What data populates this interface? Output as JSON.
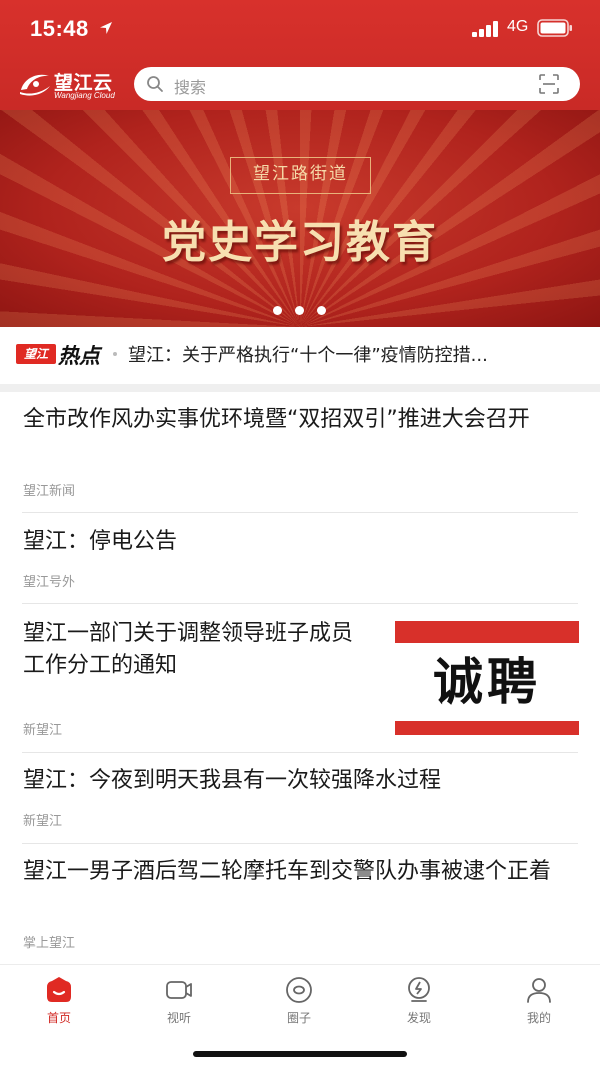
{
  "status_bar": {
    "time": "15:48",
    "network": "4G"
  },
  "header": {
    "logo_text": "望江云",
    "logo_subtext": "Wangjiang Cloud",
    "search_placeholder": "搜索"
  },
  "banner": {
    "tag": "望江路街道",
    "title": "党史学习教育",
    "slide_count": 3,
    "active_slide": 1
  },
  "hot_news": {
    "badge": "望江",
    "label": "热点",
    "text": "望江：关于严格执行“十个一律”疫情防控措..."
  },
  "feed": [
    {
      "title": "全市改作风办实事优环境暨“双招双引”推进大会召开",
      "source": "望江新闻"
    },
    {
      "title": "望江：停电公告",
      "source": "望江号外"
    },
    {
      "title": "望江一部门关于调整领导班子成员工作分工的通知",
      "source": "新望江",
      "thumbnail_text": "诚聘"
    },
    {
      "title": "望江：今夜到明天我县有一次较强降水过程",
      "source": "新望江"
    },
    {
      "title": "望江一男子酒后驾二轮摩托车到交警队办事被逮个正着",
      "source": "掌上望江"
    }
  ],
  "tabbar": {
    "items": [
      {
        "label": "首页",
        "icon": "home-icon",
        "active": true
      },
      {
        "label": "视听",
        "icon": "video-icon",
        "active": false
      },
      {
        "label": "圈子",
        "icon": "circle-icon",
        "active": false
      },
      {
        "label": "发现",
        "icon": "discover-icon",
        "active": false
      },
      {
        "label": "我的",
        "icon": "profile-icon",
        "active": false
      }
    ]
  },
  "colors": {
    "brand_red": "#d22a25",
    "banner_gold": "#f7dfb0",
    "source_gray": "#999999"
  }
}
